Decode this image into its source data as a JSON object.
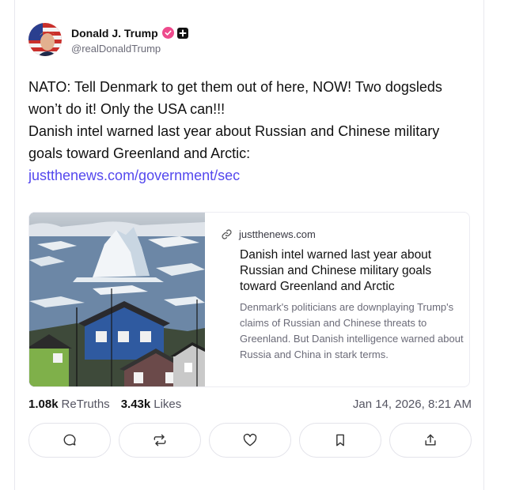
{
  "author": {
    "display_name": "Donald J. Trump",
    "handle": "@realDonaldTrump",
    "verified_color": "#ee4a8c"
  },
  "post": {
    "paragraph1": "NATO: Tell Denmark to get them out of here, NOW! Two dogsleds won’t do it! Only the USA can!!!",
    "paragraph2": "Danish intel warned last year about Russian and Chinese military goals toward Greenland and Arctic:",
    "link": "justthenews.com/government/sec"
  },
  "link_card": {
    "icon": "link-icon",
    "domain": "justthenews.com",
    "title": "Danish intel warned last year about Russian and Chinese military goals toward Greenland and Arctic",
    "description": "Denmark's politicians are downplaying Trump's claims of Russian and Chinese threats to Greenland. But Danish intelligence warned about Russia and China in stark terms."
  },
  "stats": {
    "retruths_count": "1.08k",
    "retruths_label": "ReTruths",
    "likes_count": "3.43k",
    "likes_label": "Likes",
    "timestamp": "Jan 14, 2026, 8:21 AM"
  },
  "actions": [
    {
      "icon": "reply-icon"
    },
    {
      "icon": "retruth-icon"
    },
    {
      "icon": "like-icon"
    },
    {
      "icon": "bookmark-icon"
    },
    {
      "icon": "share-icon"
    }
  ],
  "colors": {
    "accent_link": "#5448ee",
    "text": "#111111",
    "muted": "#6b6b78"
  }
}
